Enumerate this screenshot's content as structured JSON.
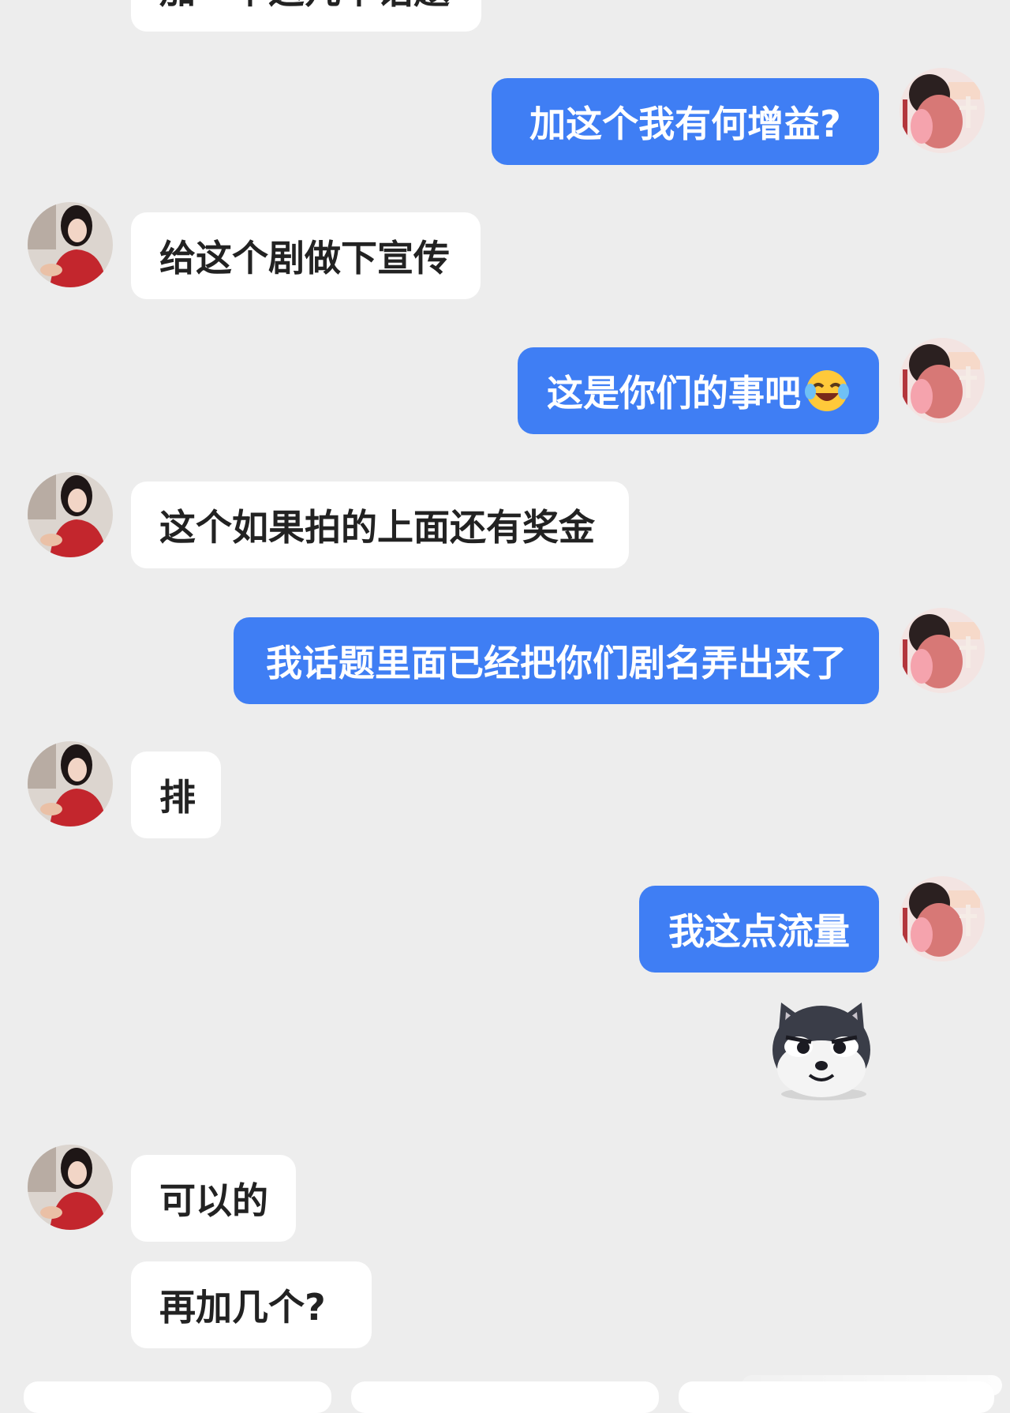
{
  "messages": [
    {
      "from": "them",
      "text": "加一个这几个话题"
    },
    {
      "from": "me",
      "text": "加这个我有何增益?"
    },
    {
      "from": "them",
      "text": "给这个剧做下宣传"
    },
    {
      "from": "me",
      "text": "这是你们的事吧",
      "emoji": "laughing-crying-emoji"
    },
    {
      "from": "them",
      "text": "这个如果拍的上面还有奖金"
    },
    {
      "from": "me",
      "text": "我话题里面已经把你们剧名弄出来了"
    },
    {
      "from": "them",
      "text": "排"
    },
    {
      "from": "me",
      "text": "我这点流量"
    },
    {
      "from": "me",
      "sticker": "husky-dog-sticker"
    },
    {
      "from": "them",
      "text": "可以的"
    },
    {
      "from": "them",
      "text": "再加几个?"
    }
  ],
  "colors": {
    "background": "#ededed",
    "incoming_bubble": "#ffffff",
    "outgoing_bubble": "#3f7ef4",
    "incoming_text": "#222222",
    "outgoing_text": "#ffffff"
  },
  "icons": {
    "their_avatar": "woman-in-red-avatar",
    "my_avatar": "anime-man-avatar"
  }
}
